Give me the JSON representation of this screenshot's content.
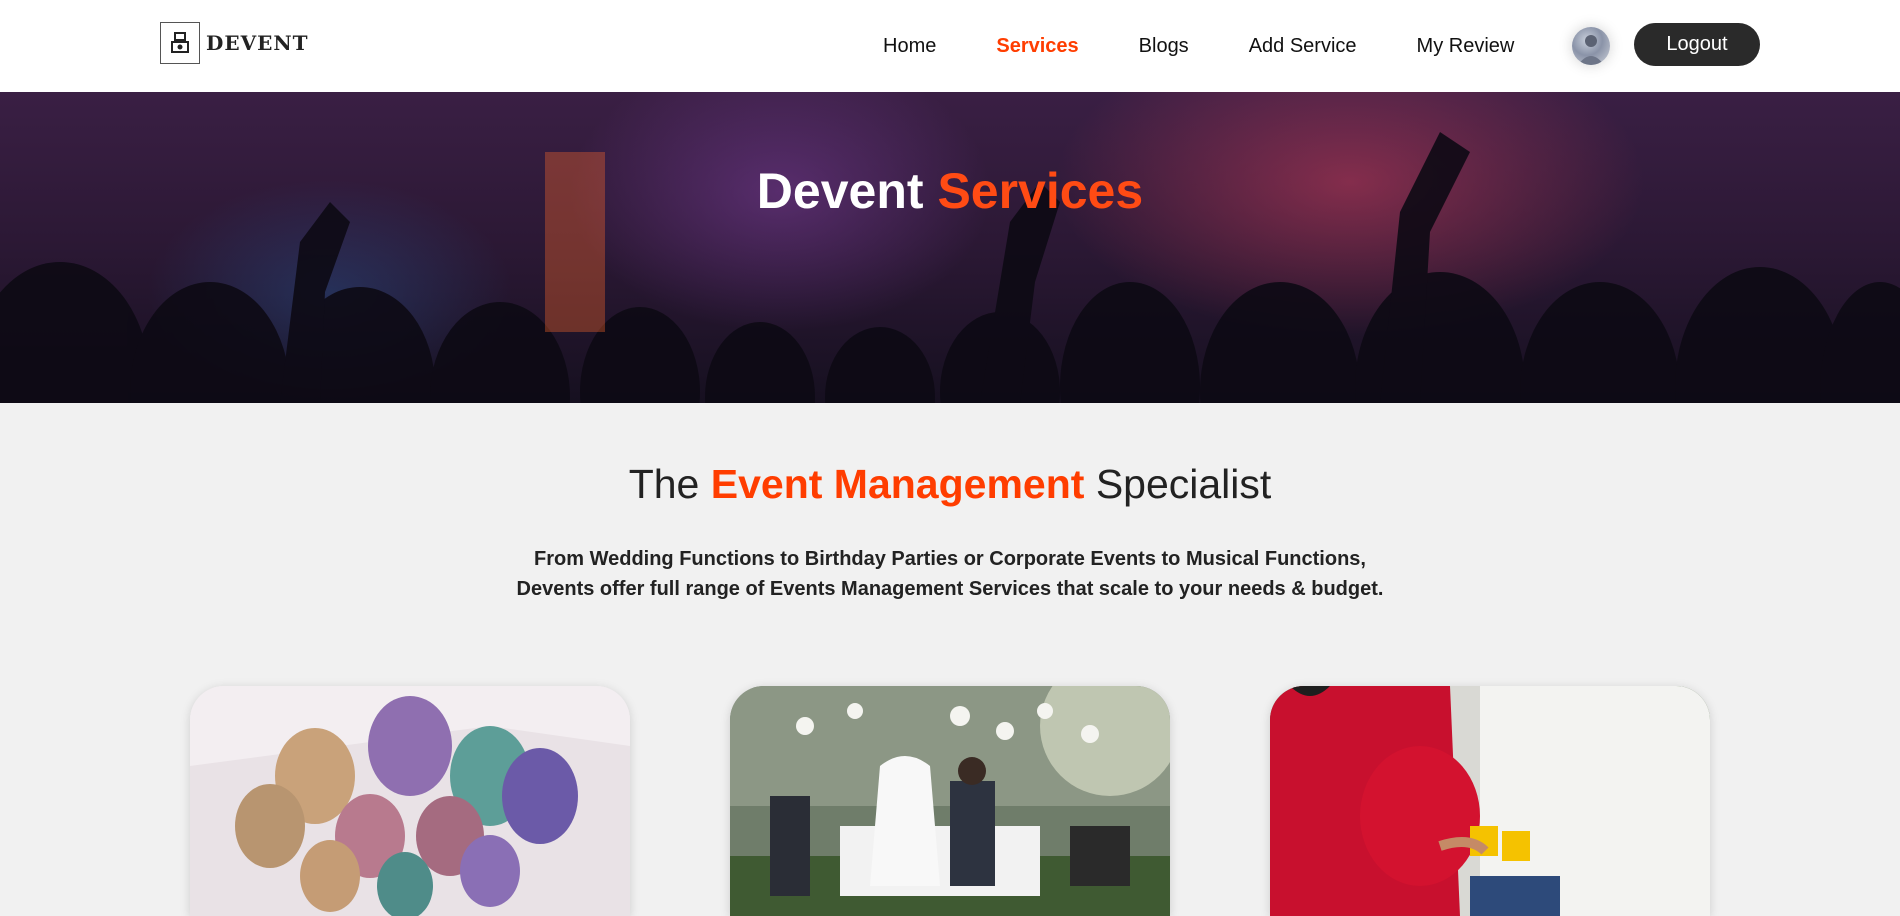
{
  "header": {
    "logo_text": "DEVENT",
    "logo_icon": "camera-stack-icon",
    "nav": [
      {
        "label": "Home",
        "active": false
      },
      {
        "label": "Services",
        "active": true
      },
      {
        "label": "Blogs",
        "active": false
      },
      {
        "label": "Add Service",
        "active": false
      },
      {
        "label": "My Review",
        "active": false
      }
    ],
    "logout_label": "Logout"
  },
  "hero": {
    "title_part1": "Devent",
    "title_part2": "Services"
  },
  "intro": {
    "title_part1": "The",
    "title_accent": "Event Management",
    "title_part2": "Specialist",
    "line1": "From Wedding Functions to Birthday Parties or Corporate Events to Musical Functions,",
    "line2": "Devents offer full range of Events Management Services that scale to your needs & budget."
  },
  "colors": {
    "accent": "#ff3d00",
    "dark_button": "#2a2a2a",
    "page_bg": "#f1f1f1"
  }
}
